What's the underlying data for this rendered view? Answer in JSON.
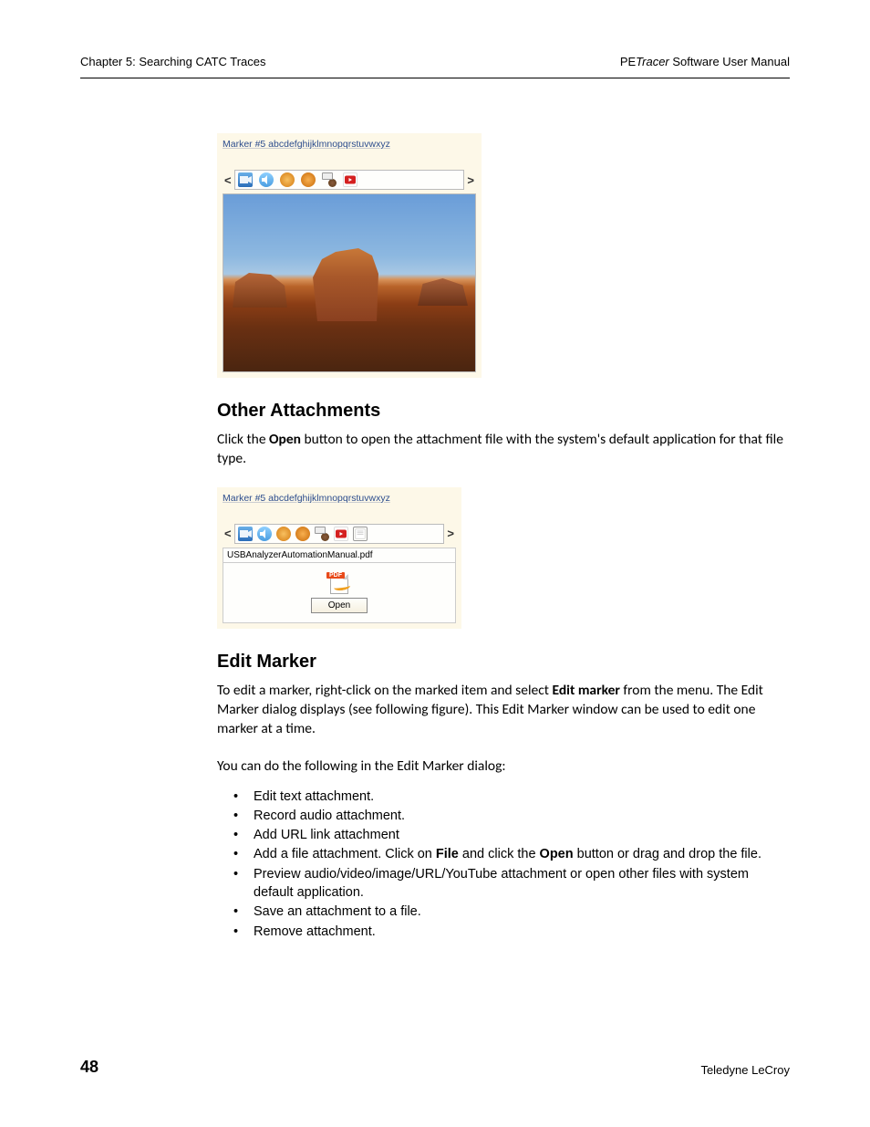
{
  "header": {
    "left": "Chapter 5: Searching CATC Traces",
    "right_pe": "PE",
    "right_tracer": "Tracer",
    "right_rest": " Software User Manual"
  },
  "fig1": {
    "title": "Marker #5 abcdefghijklmnopqrstuvwxyz",
    "arrow_left": "<",
    "arrow_right": ">"
  },
  "section1": {
    "heading": "Other Attachments",
    "p_pre": "Click the ",
    "p_bold": "Open",
    "p_post": " button to open the attachment file with the system's default application for that file type."
  },
  "fig2": {
    "title": "Marker #5 abcdefghijklmnopqrstuvwxyz",
    "arrow_left": "<",
    "arrow_right": ">",
    "filename": "USBAnalyzerAutomationManual.pdf",
    "pdf_label": "PDF",
    "open_btn": "Open"
  },
  "section2": {
    "heading": "Edit Marker",
    "p1_pre": "To edit a marker, right-click on the marked item and select ",
    "p1_bold": "Edit marker",
    "p1_post": " from the menu. The Edit Marker dialog displays (see following figure). This Edit Marker window can be used to edit one marker at a time.",
    "p2": "You can do the following in the Edit Marker dialog:",
    "bullets": {
      "b0": "Edit text attachment.",
      "b1": "Record audio attachment.",
      "b2": "Add URL link attachment",
      "b3_pre": "Add a file attachment. Click on ",
      "b3_bold1": "File",
      "b3_mid": " and click the ",
      "b3_bold2": "Open",
      "b3_post": " button or drag and drop the file.",
      "b4": "Preview audio/video/image/URL/YouTube attachment or open other files with system default application.",
      "b5": "Save an attachment to a file.",
      "b6": "Remove attachment."
    }
  },
  "footer": {
    "page": "48",
    "company": "Teledyne LeCroy"
  }
}
